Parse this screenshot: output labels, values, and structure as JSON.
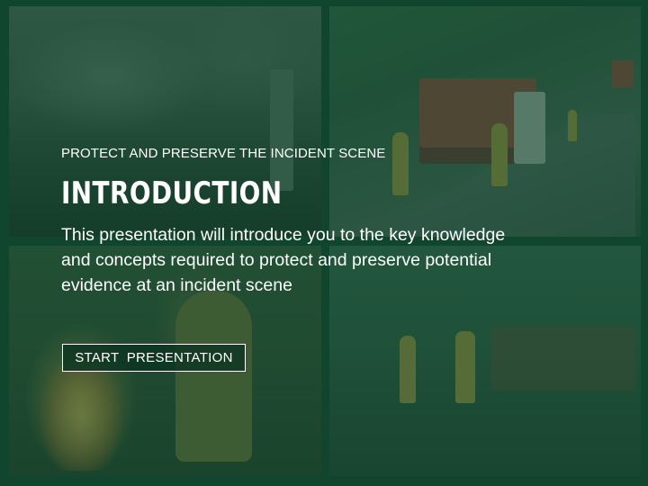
{
  "slide": {
    "eyebrow": "PROTECT AND PRESERVE THE INCIDENT SCENE",
    "title": "INTRODUCTION",
    "body": "This presentation will introduce you to the key knowledge and concepts required to protect and preserve potential evidence at an incident scene",
    "start_label": "START  PRESENTATION"
  },
  "colors": {
    "background": "#123d2b",
    "overlay": "#104a30",
    "text": "#ffffff"
  }
}
